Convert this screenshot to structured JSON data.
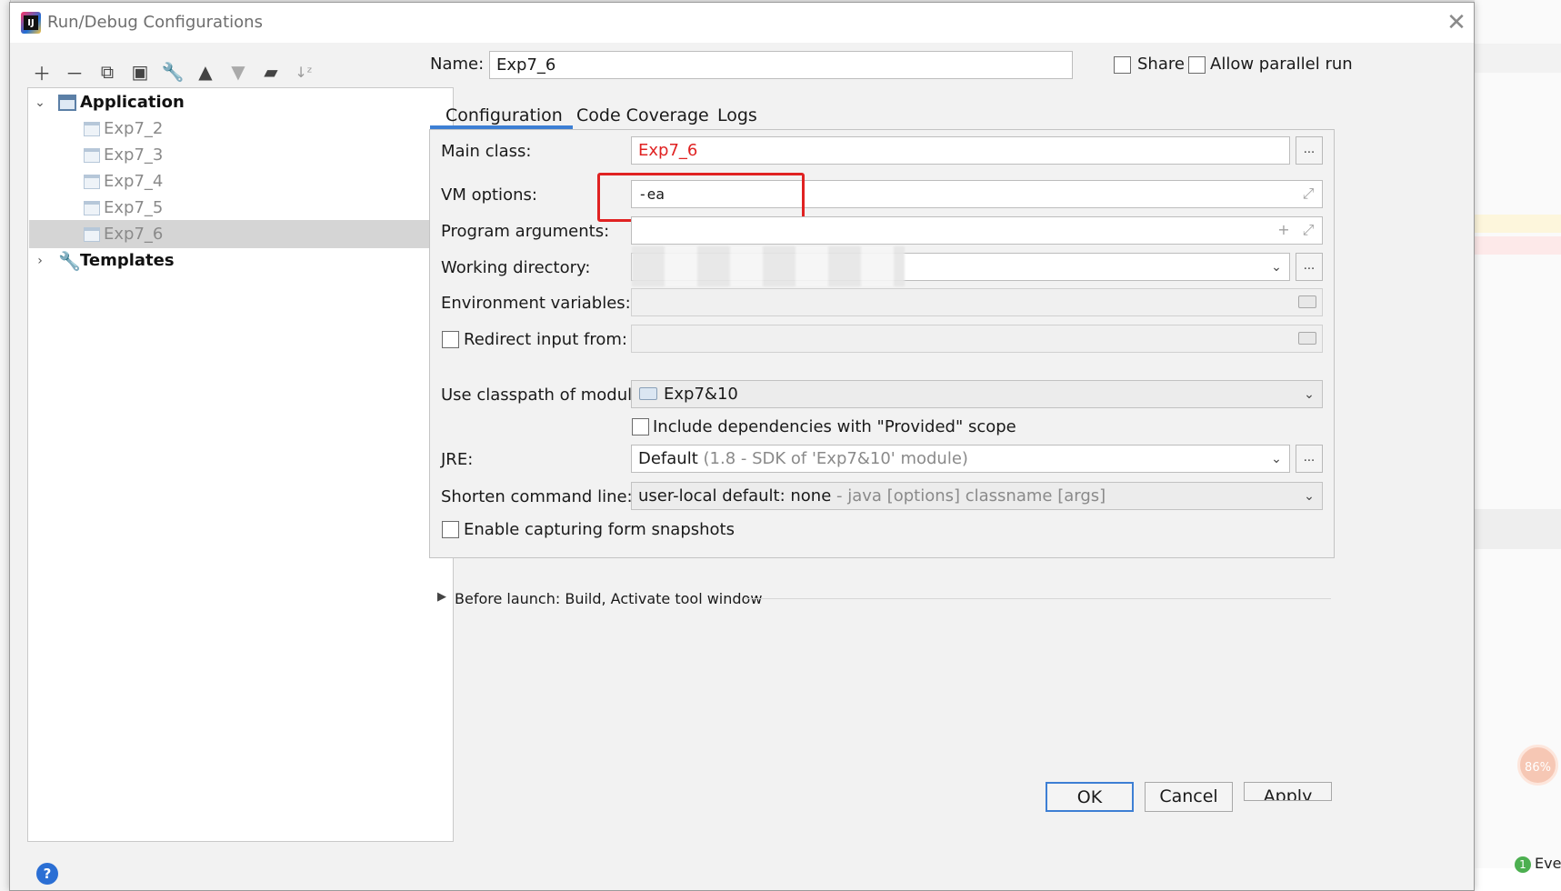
{
  "window": {
    "title": "Run/Debug Configurations"
  },
  "toolbar": {
    "icons": [
      "add-icon",
      "remove-icon",
      "copy-icon",
      "save-icon",
      "wrench-icon",
      "move-up-icon",
      "move-down-icon",
      "new-folder-icon",
      "sort-icon"
    ]
  },
  "tree": {
    "application_label": "Application",
    "items": [
      "Exp7_2",
      "Exp7_3",
      "Exp7_4",
      "Exp7_5",
      "Exp7_6"
    ],
    "selected": "Exp7_6",
    "templates_label": "Templates"
  },
  "header": {
    "name_label": "Name:",
    "name_value": "Exp7_6",
    "share_label": "Share",
    "parallel_label": "Allow parallel run"
  },
  "tabs": [
    "Configuration",
    "Code Coverage",
    "Logs"
  ],
  "active_tab": "Configuration",
  "form": {
    "main_class_label": "Main class:",
    "main_class_value": "Exp7_6",
    "vm_options_label": "VM options:",
    "vm_options_value": "-ea",
    "program_args_label": "Program arguments:",
    "working_dir_label": "Working directory:",
    "env_vars_label": "Environment variables:",
    "redirect_label": "Redirect input from:",
    "classpath_label": "Use classpath of module:",
    "classpath_value": "Exp7&10",
    "include_deps_label": "Include dependencies with \"Provided\" scope",
    "jre_label": "JRE:",
    "jre_value": "Default",
    "jre_detail": "(1.8 - SDK of 'Exp7&10' module)",
    "shorten_label": "Shorten command line:",
    "shorten_value": "user-local default: none",
    "shorten_detail": "- java [options] classname [args]",
    "snapshots_label": "Enable capturing form snapshots",
    "dots": "..."
  },
  "before_launch": "Before launch: Build, Activate tool window",
  "buttons": {
    "ok": "OK",
    "cancel": "Cancel",
    "apply": "Apply"
  },
  "help": "?",
  "side": {
    "badge": "86%",
    "event_count": "1",
    "event_label": "Eve"
  },
  "colors": {
    "accent": "#3d7fd4",
    "error_text": "#e02222",
    "highlight_box": "#e02222"
  }
}
